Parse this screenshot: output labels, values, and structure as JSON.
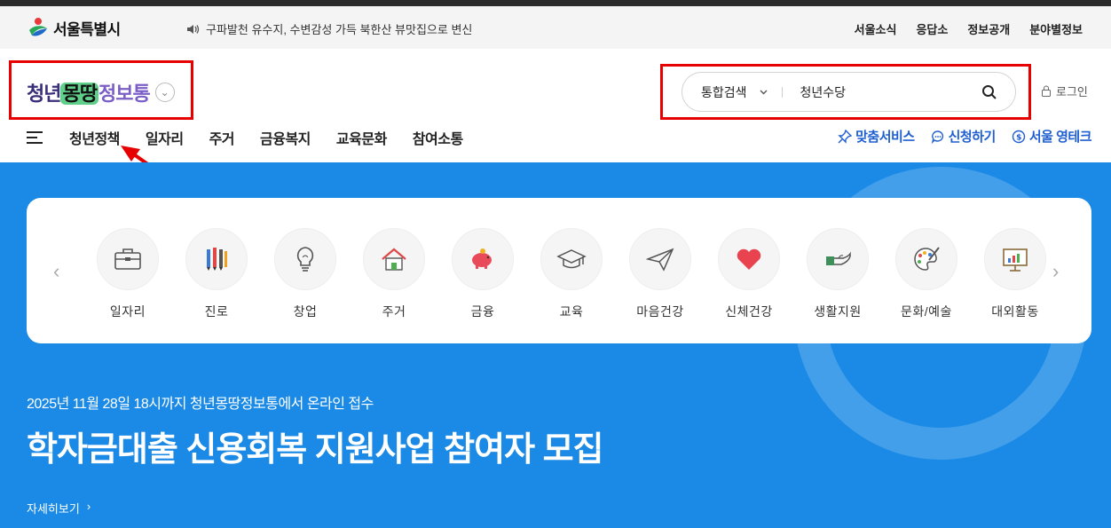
{
  "utility": {
    "seoul_logo": "서울특별시",
    "notice": "구파발천 유수지, 수변감성 가득 북한산 뷰맛집으로 변신",
    "links": [
      "서울소식",
      "응답소",
      "정보공개",
      "분야별정보"
    ]
  },
  "brand": {
    "part1": "청년",
    "part2": "몽땅",
    "part3": "정보통"
  },
  "search": {
    "scope": "통합검색",
    "value": "청년수당"
  },
  "login": "로그인",
  "nav": {
    "items": [
      "청년정책",
      "일자리",
      "주거",
      "금융복지",
      "교육문화",
      "참여소통"
    ]
  },
  "quick": {
    "items": [
      "맞춤서비스",
      "신청하기",
      "서울 영테크"
    ]
  },
  "categories": [
    {
      "label": "일자리",
      "icon": "briefcase-icon"
    },
    {
      "label": "진로",
      "icon": "pencils-icon"
    },
    {
      "label": "창업",
      "icon": "lightbulb-icon"
    },
    {
      "label": "주거",
      "icon": "house-icon"
    },
    {
      "label": "금융",
      "icon": "piggybank-icon"
    },
    {
      "label": "교육",
      "icon": "graduation-cap-icon"
    },
    {
      "label": "마음건강",
      "icon": "paper-plane-icon"
    },
    {
      "label": "신체건강",
      "icon": "heart-icon"
    },
    {
      "label": "생활지원",
      "icon": "helping-hand-icon"
    },
    {
      "label": "문화/예술",
      "icon": "palette-icon"
    },
    {
      "label": "대외활동",
      "icon": "presentation-board-icon"
    }
  ],
  "hero": {
    "subtitle": "2025년 11월 28일 18시까지 청년몽땅정보통에서 온라인 접수",
    "title": "학자금대출 신용회복 지원사업 참여자 모집",
    "more": "자세히보기"
  },
  "colors": {
    "hero_bg": "#1a8ae6",
    "accent": "#1f5fd1",
    "annotation": "#e60000"
  }
}
